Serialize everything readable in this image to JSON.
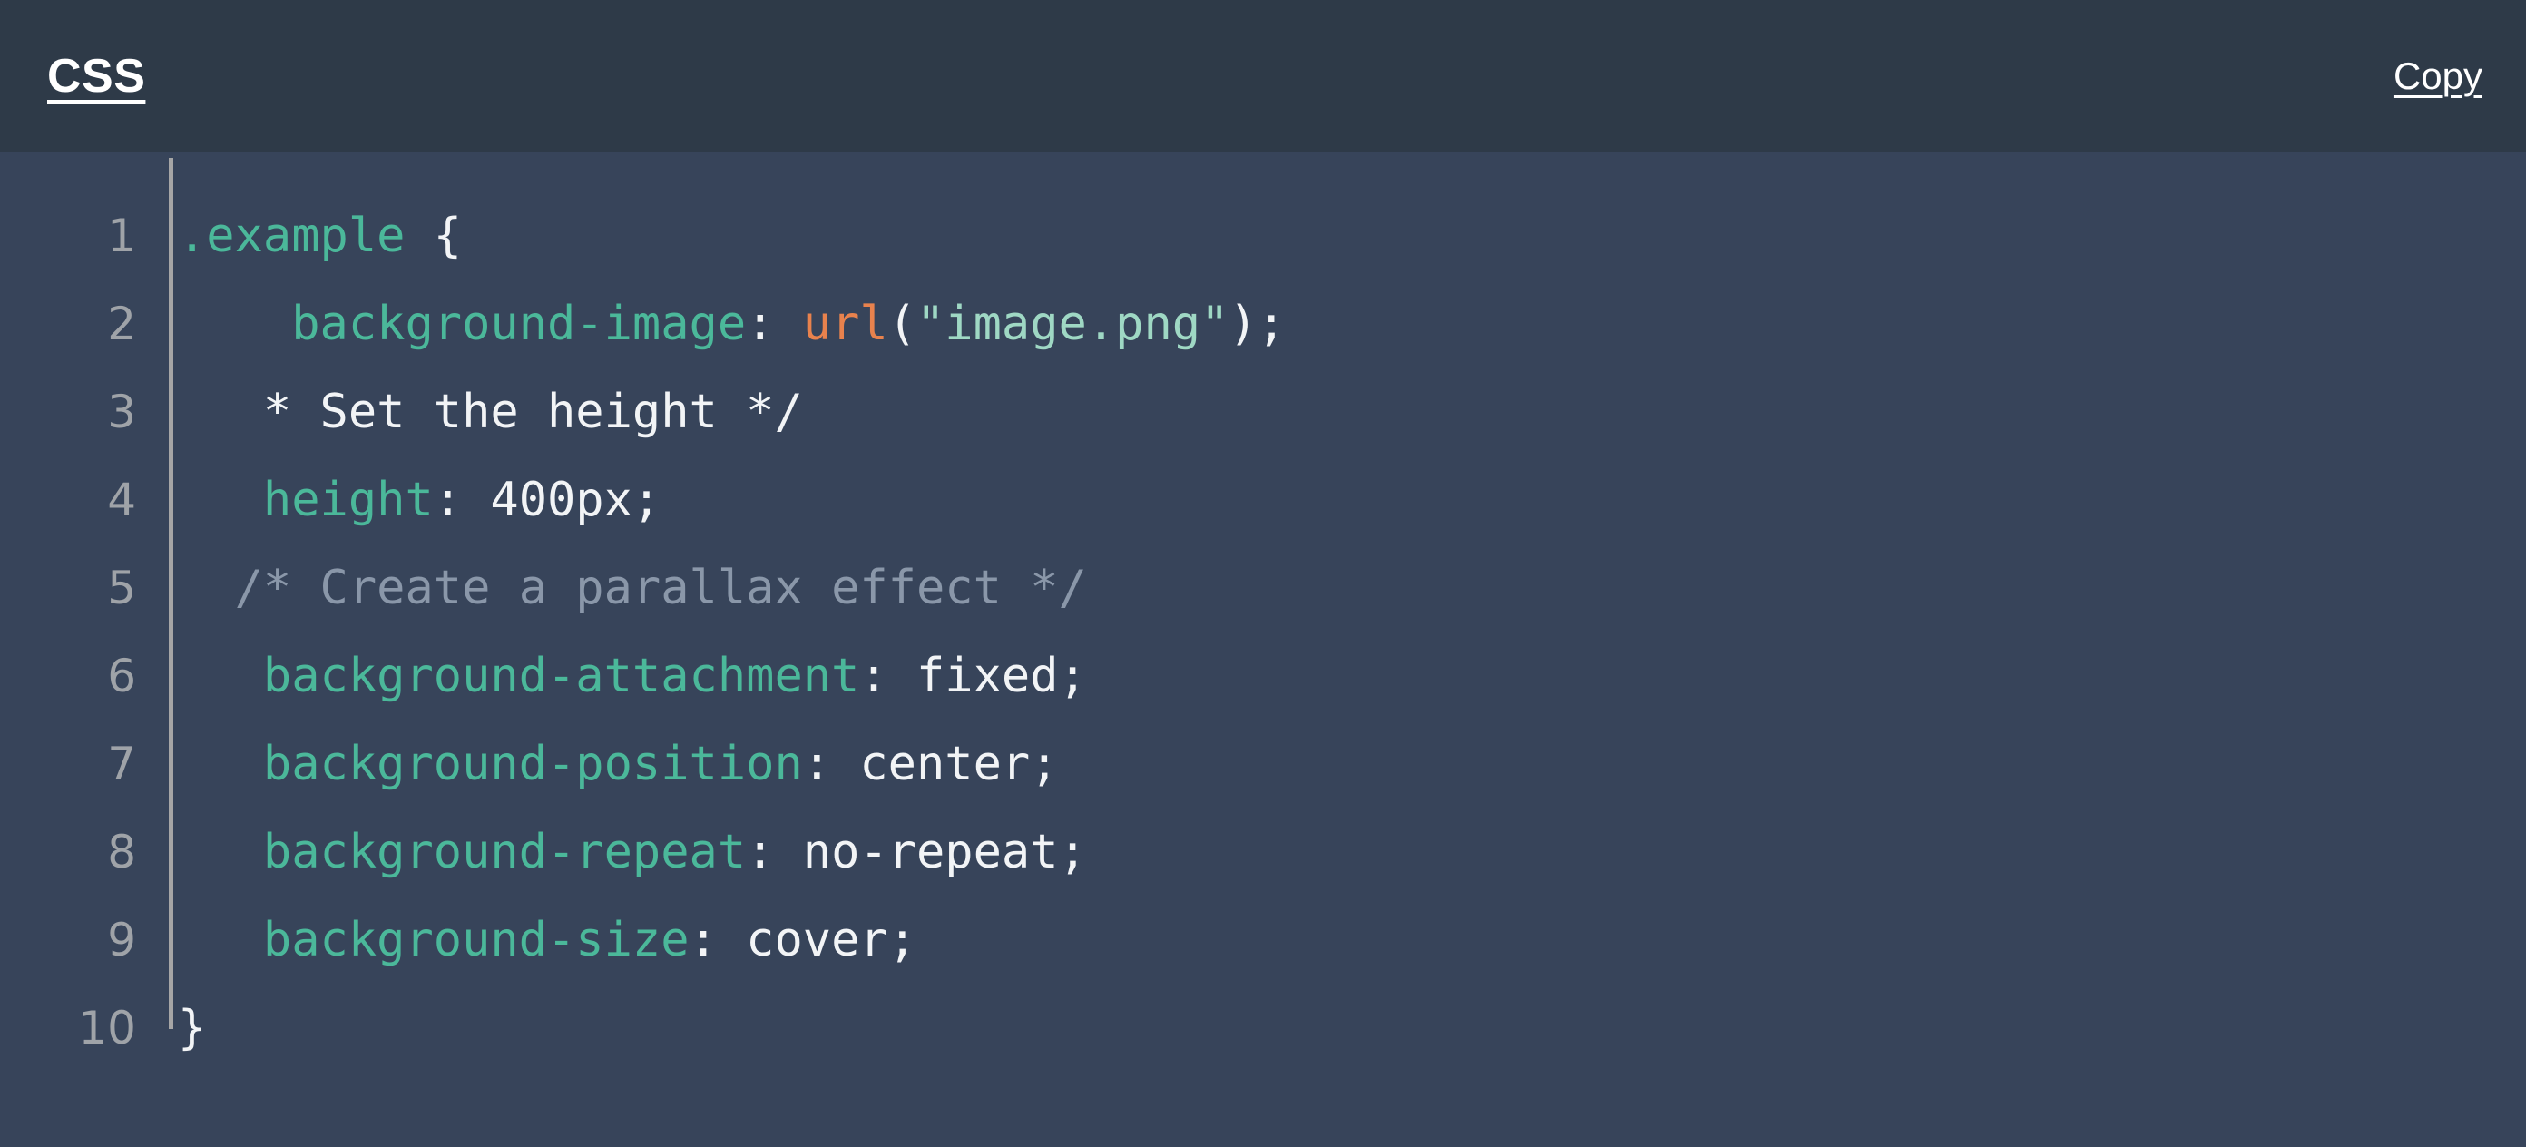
{
  "header": {
    "language_label": "CSS",
    "copy_label": "Copy"
  },
  "colors": {
    "header_bg": "#2e3a48",
    "body_bg": "#37445a",
    "gutter_rule": "#a6a6a6",
    "line_number": "#9fa3a8",
    "selector": "#4bb89a",
    "property": "#4bb89a",
    "value": "#f2f4f6",
    "punctuation": "#f2f4f6",
    "function": "#e8824d",
    "string": "#9fd8c4",
    "comment": "#8a97a9",
    "text": "#ffffff"
  },
  "code": {
    "language": "CSS",
    "line_numbers": [
      "1",
      "2",
      "3",
      "4",
      "5",
      "6",
      "7",
      "8",
      "9",
      "10"
    ],
    "plain_text": ".example {\n    background-image: url(\"image.png\");\n   * Set the height */\n   height: 400px;\n  /* Create a parallax effect */\n   background-attachment: fixed;\n   background-position: center;\n   background-repeat: no-repeat;\n   background-size: cover;\n}",
    "lines": [
      {
        "number": "1",
        "text": ".example {",
        "tokens": [
          {
            "t": ".example",
            "c": "selector"
          },
          {
            "t": " ",
            "c": "plain"
          },
          {
            "t": "{",
            "c": "punct"
          }
        ]
      },
      {
        "number": "2",
        "text": "    background-image: url(\"image.png\");",
        "tokens": [
          {
            "t": "    ",
            "c": "plain"
          },
          {
            "t": "background-image",
            "c": "property"
          },
          {
            "t": ": ",
            "c": "punct"
          },
          {
            "t": "url",
            "c": "func"
          },
          {
            "t": "(",
            "c": "punct"
          },
          {
            "t": "\"image.png\"",
            "c": "string"
          },
          {
            "t": ");",
            "c": "punct"
          }
        ]
      },
      {
        "number": "3",
        "text": "   * Set the height */",
        "tokens": [
          {
            "t": "   ",
            "c": "plain"
          },
          {
            "t": "* Set the height */",
            "c": "plain"
          }
        ]
      },
      {
        "number": "4",
        "text": "   height: 400px;",
        "tokens": [
          {
            "t": "   ",
            "c": "plain"
          },
          {
            "t": "height",
            "c": "property"
          },
          {
            "t": ": ",
            "c": "punct"
          },
          {
            "t": "400px;",
            "c": "value"
          }
        ]
      },
      {
        "number": "5",
        "text": "  /* Create a parallax effect */",
        "tokens": [
          {
            "t": "  ",
            "c": "plain"
          },
          {
            "t": "/* Create a parallax effect */",
            "c": "comment"
          }
        ]
      },
      {
        "number": "6",
        "text": "   background-attachment: fixed;",
        "tokens": [
          {
            "t": "   ",
            "c": "plain"
          },
          {
            "t": "background-attachment",
            "c": "property"
          },
          {
            "t": ": ",
            "c": "punct"
          },
          {
            "t": "fixed;",
            "c": "value"
          }
        ]
      },
      {
        "number": "7",
        "text": "   background-position: center;",
        "tokens": [
          {
            "t": "   ",
            "c": "plain"
          },
          {
            "t": "background-position",
            "c": "property"
          },
          {
            "t": ": ",
            "c": "punct"
          },
          {
            "t": "center;",
            "c": "value"
          }
        ]
      },
      {
        "number": "8",
        "text": "   background-repeat: no-repeat;",
        "tokens": [
          {
            "t": "   ",
            "c": "plain"
          },
          {
            "t": "background-repeat",
            "c": "property"
          },
          {
            "t": ": ",
            "c": "punct"
          },
          {
            "t": "no-repeat;",
            "c": "value"
          }
        ]
      },
      {
        "number": "9",
        "text": "   background-size: cover;",
        "tokens": [
          {
            "t": "   ",
            "c": "plain"
          },
          {
            "t": "background-size",
            "c": "property"
          },
          {
            "t": ": ",
            "c": "punct"
          },
          {
            "t": "cover;",
            "c": "value"
          }
        ]
      },
      {
        "number": "10",
        "text": "}",
        "tokens": [
          {
            "t": "}",
            "c": "punct"
          }
        ]
      }
    ]
  }
}
